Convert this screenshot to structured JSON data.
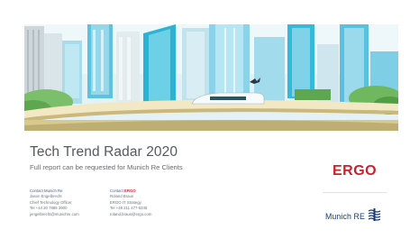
{
  "slide": {
    "title": "Tech Trend Radar 2020",
    "subtitle": "Full report can be requested for Munich Re Clients"
  },
  "contacts": {
    "munich": {
      "heading": "Contact Munich Re",
      "lines": [
        "Jason Engelbrecht",
        "Chief Technology Officer",
        "Tel +44 20 7886 3900",
        "jengelbrecht@munichre.com"
      ]
    },
    "ergo": {
      "heading_prefix": "Contact ",
      "heading_brand": "ERGO",
      "lines": [
        "Roland Braun",
        "ERGO IT Strategy",
        "Tel +49 211 477-5245",
        "roland.braun@ergo.com"
      ]
    }
  },
  "logos": {
    "ergo": "ERGO",
    "munich_re": "Munich RE",
    "munich_re_icon": "munich-re-wave-icon"
  },
  "colors": {
    "ergo_red": "#c8232c",
    "munich_blue": "#163a78",
    "title_gray": "#555a5f",
    "banner_sky": "#dfeef2",
    "banner_teal": "#1ea5c7"
  }
}
